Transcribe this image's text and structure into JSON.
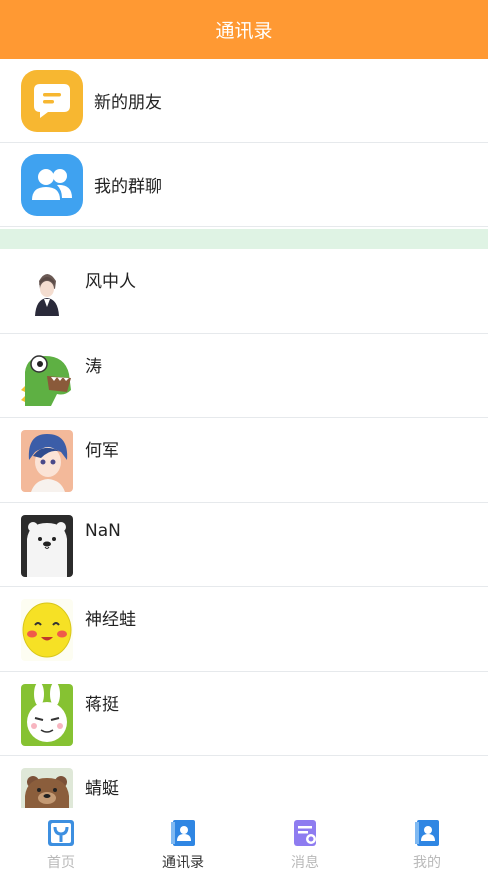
{
  "header": {
    "title": "通讯录"
  },
  "top_items": [
    {
      "label": "新的朋友",
      "icon": "chat-bubble-icon",
      "color": "#F7B731"
    },
    {
      "label": "我的群聊",
      "icon": "group-people-icon",
      "color": "#3FA2F0"
    }
  ],
  "contacts": [
    {
      "name": "风中人",
      "avatar": "anime-boy-avatar"
    },
    {
      "name": "涛",
      "avatar": "green-dinosaur-avatar"
    },
    {
      "name": "何军",
      "avatar": "anime-blue-hair-avatar"
    },
    {
      "name": "NaN",
      "avatar": "polar-bear-avatar"
    },
    {
      "name": "神经蛙",
      "avatar": "yellow-emoji-avatar"
    },
    {
      "name": "蒋挺",
      "avatar": "rabbit-avatar"
    },
    {
      "name": "蜻蜓",
      "avatar": "brown-bear-avatar"
    }
  ],
  "tabbar": {
    "tabs": [
      {
        "label": "首页",
        "icon": "home-icon",
        "active": false
      },
      {
        "label": "通讯录",
        "icon": "contacts-icon",
        "active": true
      },
      {
        "label": "消息",
        "icon": "message-icon",
        "active": false
      },
      {
        "label": "我的",
        "icon": "profile-icon",
        "active": false
      }
    ]
  },
  "colors": {
    "header": "#FF9933",
    "section_gap": "#DFF3E4",
    "tab_inactive": "#B9B9B9"
  }
}
